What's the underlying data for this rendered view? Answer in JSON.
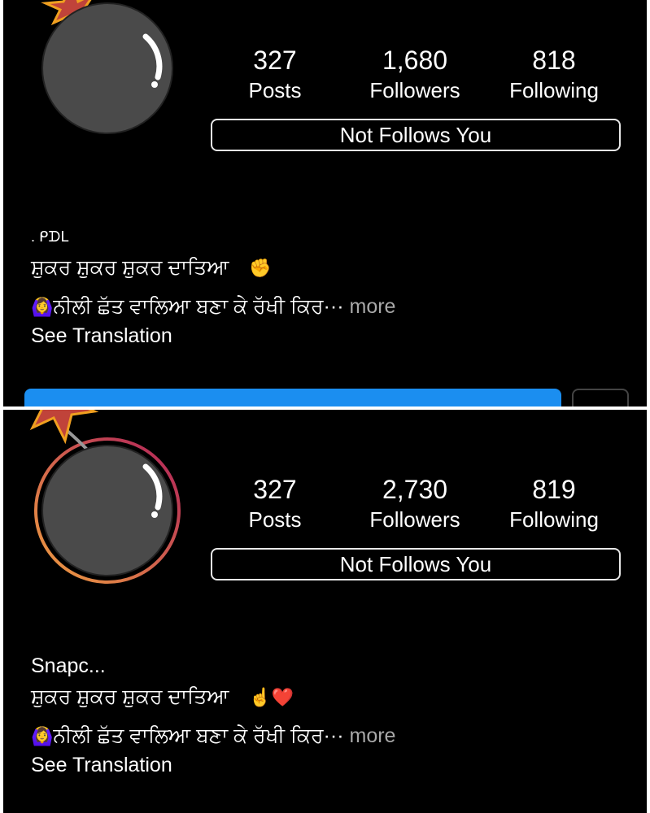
{
  "profiles": [
    {
      "stats": {
        "posts": {
          "value": "327",
          "label": "Posts"
        },
        "followers": {
          "value": "1,680",
          "label": "Followers"
        },
        "following": {
          "value": "818",
          "label": "Following"
        }
      },
      "follow_status": "Not Follows You",
      "bio": {
        "name_fragment": ". ᑭᗪᒪ",
        "line1": "ਸ਼ੁਕਰ ਸ਼ੁਕਰ ਸ਼ੁਕਰ ਦਾਤਿਆ",
        "line1_emoji": "✊",
        "line2_emoji": "🙆‍♀️",
        "line2": "ਨੀਲੀ ਛੱਤ ਵਾਲਿਆ ਬਣਾ ਕੇ ਰੱਖੀ ਕਿਰ···",
        "more": "more",
        "see_translation": "See Translation"
      }
    },
    {
      "stats": {
        "posts": {
          "value": "327",
          "label": "Posts"
        },
        "followers": {
          "value": "2,730",
          "label": "Followers"
        },
        "following": {
          "value": "819",
          "label": "Following"
        }
      },
      "follow_status": "Not Follows You",
      "bio": {
        "name_fragment": "Snapc...",
        "line1": "ਸ਼ੁਕਰ ਸ਼ੁਕਰ ਸ਼ੁਕਰ ਦਾਤਿਆ",
        "line1_emoji": "☝️❤️",
        "line2_emoji": "🙆‍♀️",
        "line2": "ਨੀਲੀ ਛੱਤ ਵਾਲਿਆ ਬਣਾ ਕੇ ਰੱਖੀ ਕਿਰ···",
        "more": "more",
        "see_translation": "See Translation"
      }
    }
  ],
  "colors": {
    "background": "#000000",
    "accent_blue": "#1b8ef0",
    "bomb": "#4a4a4a",
    "star": "#c0433a"
  }
}
